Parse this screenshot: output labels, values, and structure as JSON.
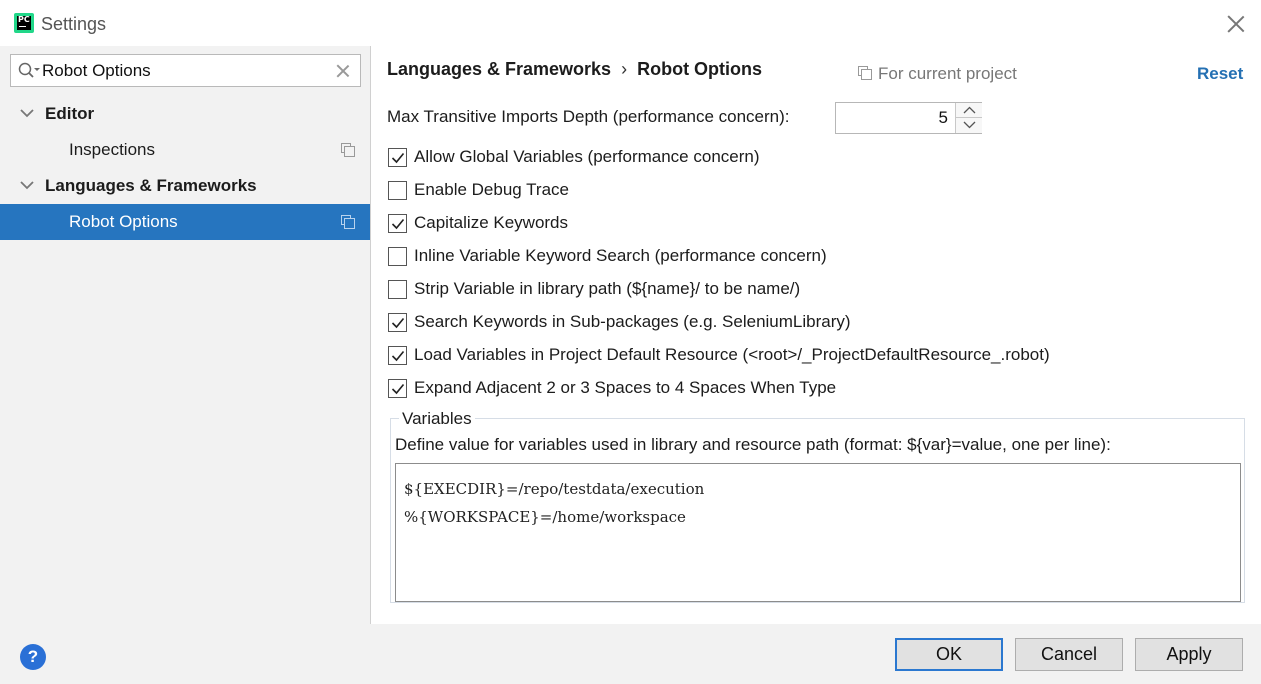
{
  "window": {
    "title": "Settings",
    "app_icon": "pycharm-icon",
    "app_icon_text": "PC"
  },
  "sidebar": {
    "search": {
      "value": "Robot Options",
      "icon": "search-icon"
    },
    "tree": [
      {
        "label": "Editor",
        "expanded": true
      },
      {
        "label": "Inspections"
      },
      {
        "label": "Languages & Frameworks",
        "expanded": true
      },
      {
        "label": "Robot Options",
        "selected": true
      }
    ]
  },
  "header": {
    "breadcrumb": [
      "Languages & Frameworks",
      "Robot Options"
    ],
    "breadcrumb_separator": "›",
    "scope_label": "For current project",
    "reset_label": "Reset"
  },
  "settings": {
    "max_depth_label": "Max Transitive Imports Depth (performance concern):",
    "max_depth_value": "5",
    "checkboxes": [
      {
        "label": "Allow Global Variables (performance concern)",
        "checked": true
      },
      {
        "label": "Enable Debug Trace",
        "checked": false
      },
      {
        "label": "Capitalize Keywords",
        "checked": true
      },
      {
        "label": "Inline Variable Keyword Search (performance concern)",
        "checked": false
      },
      {
        "label": "Strip Variable in library path (${name}/ to be name/)",
        "checked": false
      },
      {
        "label": "Search Keywords in Sub-packages (e.g. SeleniumLibrary)",
        "checked": true
      },
      {
        "label": "Load Variables in Project Default Resource (<root>/_ProjectDefaultResource_.robot)",
        "checked": true
      },
      {
        "label": "Expand Adjacent 2 or 3 Spaces to 4 Spaces When Type",
        "checked": true
      }
    ]
  },
  "variables": {
    "legend": "Variables",
    "description": "Define value for variables used in library and resource path (format: ${var}=value, one per line):",
    "lines": [
      "${EXECDIR}=/repo/testdata/execution",
      "%{WORKSPACE}=/home/workspace"
    ]
  },
  "footer": {
    "help_label": "?",
    "ok_label": "OK",
    "cancel_label": "Cancel",
    "apply_label": "Apply"
  },
  "colors": {
    "selection": "#2675bf",
    "link": "#2470b3",
    "help": "#2a70d6",
    "sidebar_bg": "#f2f2f2"
  }
}
